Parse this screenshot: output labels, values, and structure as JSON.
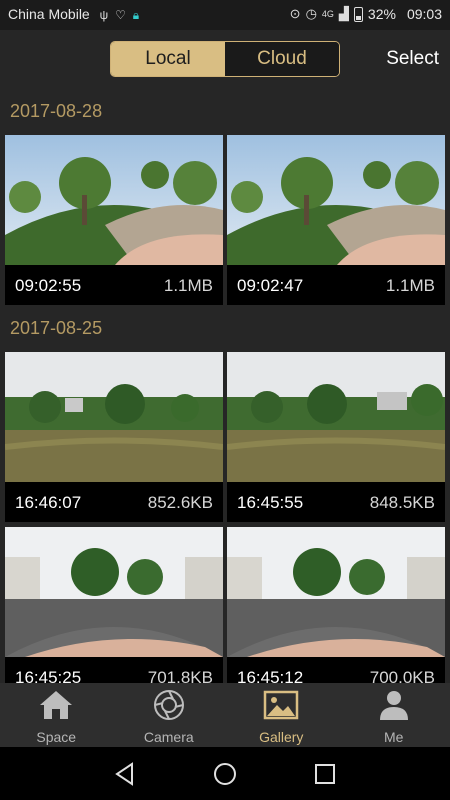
{
  "status_bar": {
    "carrier": "China Mobile",
    "network": "4G",
    "battery": "32%",
    "time": "09:03",
    "icons": [
      "usb-icon",
      "health-icon",
      "lock-icon",
      "location-icon",
      "alarm-icon",
      "signal-icon",
      "battery-icon"
    ]
  },
  "header": {
    "tabs": [
      {
        "label": "Local",
        "active": true
      },
      {
        "label": "Cloud",
        "active": false
      }
    ],
    "select_label": "Select"
  },
  "gallery": {
    "groups": [
      {
        "date": "2017-08-28",
        "items": [
          {
            "time": "09:02:55",
            "size": "1.1MB"
          },
          {
            "time": "09:02:47",
            "size": "1.1MB"
          }
        ]
      },
      {
        "date": "2017-08-25",
        "items": [
          {
            "time": "16:46:07",
            "size": "852.6KB"
          },
          {
            "time": "16:45:55",
            "size": "848.5KB"
          },
          {
            "time": "16:45:25",
            "size": "701.8KB"
          },
          {
            "time": "16:45:12",
            "size": "700.0KB"
          }
        ]
      }
    ]
  },
  "bottom_nav": {
    "items": [
      {
        "label": "Space",
        "icon": "home-icon"
      },
      {
        "label": "Camera",
        "icon": "camera-shutter-icon"
      },
      {
        "label": "Gallery",
        "icon": "gallery-icon",
        "active": true
      },
      {
        "label": "Me",
        "icon": "person-icon"
      }
    ]
  },
  "colors": {
    "accent": "#d9be83",
    "background": "#262626",
    "date_text": "#b49a63"
  }
}
